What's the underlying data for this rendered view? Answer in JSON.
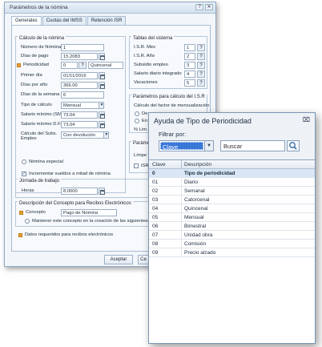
{
  "main": {
    "title": "Parámetros de la nómina",
    "tabs": [
      "Generales",
      "Cuotas del IMSS",
      "Retención ISR"
    ],
    "calculo": {
      "title": "Cálculo de la nómina",
      "numero_label": "Número de Nómina",
      "numero_value": "1",
      "dias_pago_label": "Días de pago",
      "dias_pago_value": "15.2083",
      "periodicidad_label": "Periodicidad",
      "periodicidad_value": "0",
      "periodicidad_desc": "Quincenal",
      "primer_dia_label": "Primer día",
      "primer_dia_value": "01/11/2016",
      "dias_anio_label": "Días por año",
      "dias_anio_value": "366.00",
      "dias_semana_label": "Días de la semana",
      "dias_semana_value": "6",
      "tipo_calculo_label": "Tipo de cálculo",
      "tipo_calculo_value": "Mensual",
      "sm_label": "Salario mínimo (SM)",
      "sm_value": "73.04",
      "smdf_label": "Salario mínimo D.F.",
      "smdf_value": "73.04",
      "calculo_subs_label": "Cálculo del Subs. Empleo",
      "calculo_subs_value": "Con devolución",
      "nomina_especial": "Nómina especial",
      "incrementar": "Incrementar sueldos a mitad de nómina"
    },
    "tablas": {
      "title": "Tablas del sistema",
      "isr_mes": "I.S.R. Mes",
      "isr_mes_value": "1",
      "isr_anio": "I.S.R. Año",
      "isr_anio_value": "2",
      "subsidio": "Subsidio empleo",
      "subsidio_value": "3",
      "sdi": "Salario diario integrado",
      "sdi_value": "4",
      "vacaciones": "Vacaciones",
      "vacaciones_value": "5"
    },
    "isr": {
      "title": "Parámetros para cálculo del I.S.R",
      "factor_title": "Cálculo del factor de mensualización",
      "opt1": "De a",
      "opt2": "En ba",
      "lim": "% Lim. Imp"
    },
    "params": {
      "title": "Parámetros",
      "limpe": "Límpe en",
      "isr_en": "ISR en"
    },
    "jornada": {
      "title": "Jornada de trabajo",
      "horas_label": "Horas",
      "horas_value": "8.0000"
    },
    "recibos": {
      "title": "Descripción del Concepto para Recibos Electrónicos",
      "concepto_label": "Concepto",
      "concepto_value": "Pago de Nómina",
      "mantener": "Mantener este concepto en la creación de las siguientes nóminas"
    },
    "footer_note": "Datos requeridos para recibos electrónicos",
    "aceptar": "Aceptar",
    "cerrar": "Ce"
  },
  "popup": {
    "title": "Ayuda de Tipo de Periodicidad",
    "close": "⌧",
    "filter_label": "Filtrar por:",
    "filter_value": "Clave",
    "search_placeholder": "Buscar",
    "columns": [
      "Clave",
      "Descripción"
    ],
    "rows": [
      {
        "clave": "0",
        "desc": "Tipo de periodicidad"
      },
      {
        "clave": "01",
        "desc": "Diario"
      },
      {
        "clave": "02",
        "desc": "Semanal"
      },
      {
        "clave": "03",
        "desc": "Catorcenal"
      },
      {
        "clave": "04",
        "desc": "Quincenal"
      },
      {
        "clave": "05",
        "desc": "Mensual"
      },
      {
        "clave": "06",
        "desc": "Bimestral"
      },
      {
        "clave": "07",
        "desc": "Unidad obra"
      },
      {
        "clave": "08",
        "desc": "Comisión"
      },
      {
        "clave": "09",
        "desc": "Precio alzado"
      }
    ]
  }
}
